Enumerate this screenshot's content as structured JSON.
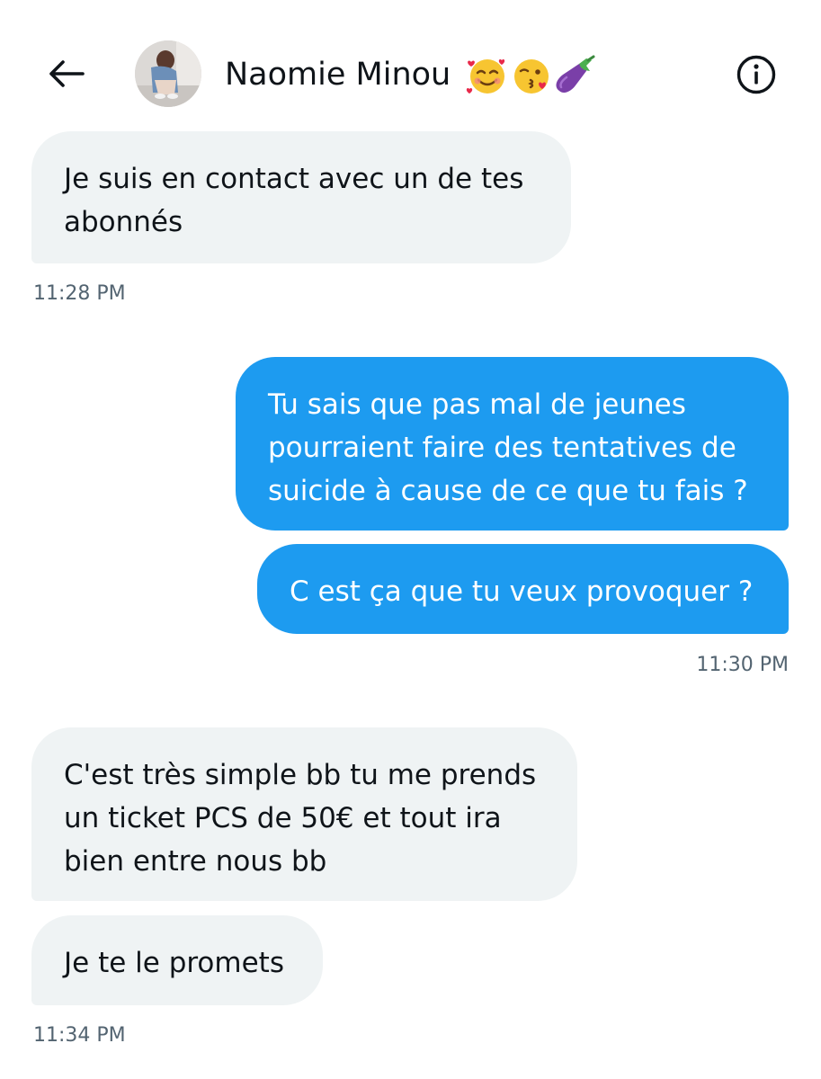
{
  "header": {
    "back_icon": "arrow-left-icon",
    "avatar": "contact-avatar-photo",
    "contact_name": "Naomie Minou",
    "name_emojis": [
      "smiling-face-with-hearts",
      "face-blowing-a-kiss",
      "eggplant"
    ],
    "info_icon": "info-circle-icon"
  },
  "messages": [
    {
      "direction": "incoming",
      "lines": [
        "Je suis en contact avec un de tes",
        "abonnés"
      ]
    },
    {
      "direction": "outgoing",
      "lines": [
        "Tu sais que pas mal de jeunes",
        "pourraient faire des tentatives de",
        "suicide à cause de ce que tu fais ?"
      ]
    },
    {
      "direction": "outgoing",
      "lines": [
        "C est ça que tu veux provoquer ?"
      ]
    },
    {
      "direction": "incoming",
      "lines": [
        "C'est très simple bb tu me prends",
        "un ticket PCS de 50€ et tout ira",
        "bien entre nous bb"
      ]
    },
    {
      "direction": "incoming",
      "lines": [
        "Je te le promets"
      ]
    }
  ],
  "timestamps": [
    "11:28 PM",
    "11:30 PM",
    "11:34 PM"
  ],
  "colors": {
    "outgoing_bubble": "#1d9bf0",
    "incoming_bubble": "#eff3f4",
    "timestamp_text": "#536471",
    "primary_text": "#0f1419"
  }
}
